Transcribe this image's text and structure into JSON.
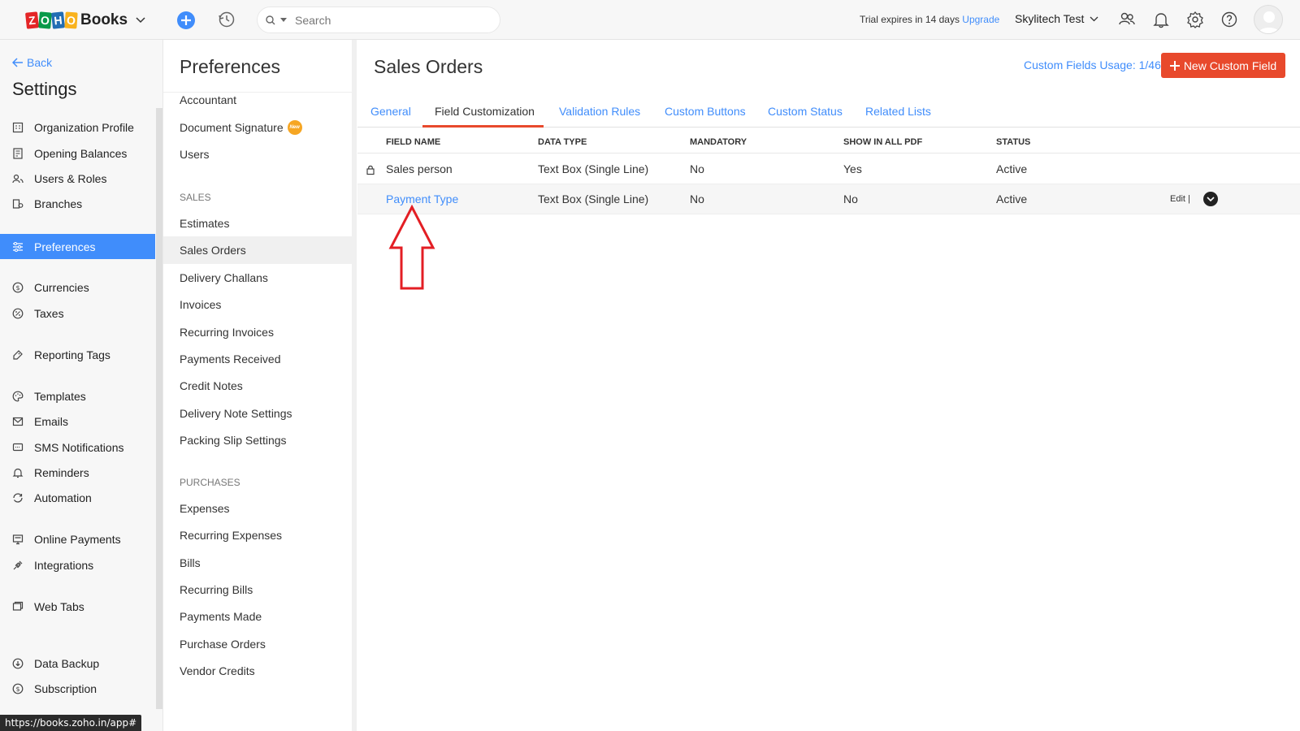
{
  "topbar": {
    "logo_zoho": [
      "Z",
      "O",
      "H",
      "O"
    ],
    "logo_text": "Books",
    "search_placeholder": "Search",
    "trial_text": "Trial expires in 14 days",
    "upgrade_label": "Upgrade",
    "org_name": "Skylitech Test"
  },
  "leftnav": {
    "back_label": "Back",
    "title": "Settings",
    "items": [
      {
        "label": "Organization Profile",
        "icon": "building-icon"
      },
      {
        "label": "Opening Balances",
        "icon": "ledger-icon"
      },
      {
        "label": "Users & Roles",
        "icon": "users-icon"
      },
      {
        "label": "Branches",
        "icon": "branch-icon"
      },
      {
        "label": "Preferences",
        "icon": "sliders-icon"
      },
      {
        "label": "Currencies",
        "icon": "currency-icon"
      },
      {
        "label": "Taxes",
        "icon": "percent-icon"
      },
      {
        "label": "Reporting Tags",
        "icon": "tag-icon"
      },
      {
        "label": "Templates",
        "icon": "palette-icon"
      },
      {
        "label": "Emails",
        "icon": "email-icon"
      },
      {
        "label": "SMS Notifications",
        "icon": "sms-icon"
      },
      {
        "label": "Reminders",
        "icon": "bell-icon"
      },
      {
        "label": "Automation",
        "icon": "automation-icon"
      },
      {
        "label": "Online Payments",
        "icon": "payment-icon"
      },
      {
        "label": "Integrations",
        "icon": "plug-icon"
      },
      {
        "label": "Web Tabs",
        "icon": "webtab-icon"
      },
      {
        "label": "Data Backup",
        "icon": "backup-icon"
      },
      {
        "label": "Subscription",
        "icon": "subscription-icon"
      }
    ],
    "status_url": "https://books.zoho.in/app#"
  },
  "preferences": {
    "title": "Preferences",
    "general_items": [
      "Accountant",
      "Document Signature",
      "Users"
    ],
    "new_badge": "New",
    "sales_section": "SALES",
    "sales_items": [
      "Estimates",
      "Sales Orders",
      "Delivery Challans",
      "Invoices",
      "Recurring Invoices",
      "Payments Received",
      "Credit Notes",
      "Delivery Note Settings",
      "Packing Slip Settings"
    ],
    "purchases_section": "PURCHASES",
    "purchases_items": [
      "Expenses",
      "Recurring Expenses",
      "Bills",
      "Recurring Bills",
      "Payments Made",
      "Purchase Orders",
      "Vendor Credits"
    ]
  },
  "main": {
    "title": "Sales Orders",
    "usage": "Custom Fields Usage: 1/46",
    "new_button": "New Custom Field",
    "tabs": [
      "General",
      "Field Customization",
      "Validation Rules",
      "Custom Buttons",
      "Custom Status",
      "Related Lists"
    ],
    "active_tab": "Field Customization",
    "table": {
      "headers": [
        "FIELD NAME",
        "DATA TYPE",
        "MANDATORY",
        "SHOW IN ALL PDF",
        "STATUS"
      ],
      "rows": [
        {
          "field": "Sales person",
          "type": "Text Box (Single Line)",
          "mandatory": "No",
          "pdf": "Yes",
          "status": "Active"
        },
        {
          "field": "Payment Type",
          "type": "Text Box (Single Line)",
          "mandatory": "No",
          "pdf": "No",
          "status": "Active"
        }
      ],
      "edit_label": "Edit"
    },
    "annotation_color": "#e31e24"
  },
  "colors": {
    "accent": "#408dfb",
    "brand_red": "#e8492c"
  }
}
